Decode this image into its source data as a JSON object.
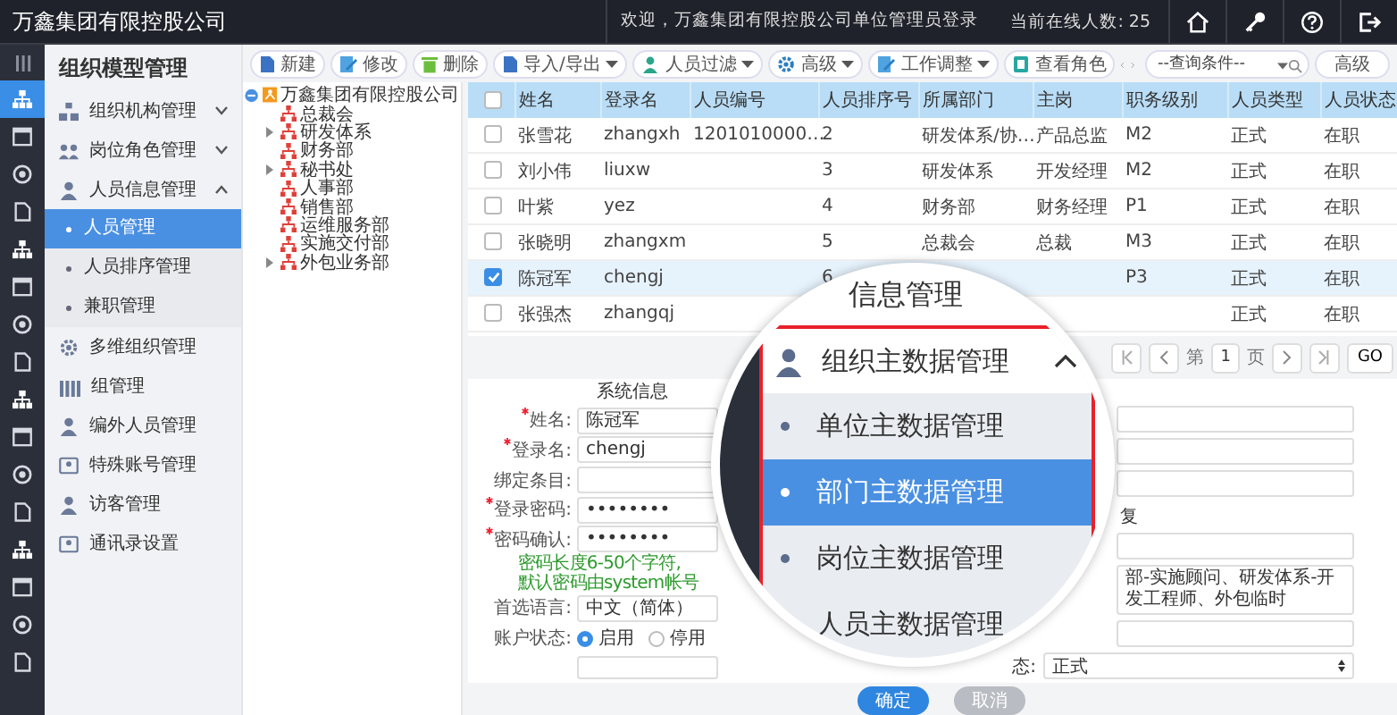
{
  "top_bar": {
    "title": "万鑫集团有限控股公司",
    "welcome": "欢迎，万鑫集团有限控股公司单位管理员登录",
    "online": "当前在线人数: 25"
  },
  "rail": [
    {
      "selected": true
    },
    {
      "selected": false
    },
    {
      "selected": false
    },
    {
      "selected": false
    },
    {
      "selected": false
    },
    {
      "selected": false
    },
    {
      "selected": false
    },
    {
      "selected": false
    },
    {
      "selected": false
    },
    {
      "selected": false
    },
    {
      "selected": false
    },
    {
      "selected": false
    },
    {
      "selected": false
    },
    {
      "selected": false
    },
    {
      "selected": false
    },
    {
      "selected": false
    }
  ],
  "sidebar": {
    "title": "组织模型管理",
    "items": [
      {
        "label": "组织机构管理",
        "expanded": false
      },
      {
        "label": "岗位角色管理",
        "expanded": false
      },
      {
        "label": "人员信息管理",
        "expanded": true,
        "children": [
          {
            "label": "人员管理",
            "selected": true
          },
          {
            "label": "人员排序管理",
            "selected": false
          },
          {
            "label": "兼职管理",
            "selected": false
          }
        ]
      },
      {
        "label": "多维组织管理"
      },
      {
        "label": "组管理"
      },
      {
        "label": "编外人员管理"
      },
      {
        "label": "特殊账号管理"
      },
      {
        "label": "访客管理"
      },
      {
        "label": "通讯录设置"
      }
    ]
  },
  "toolbar": {
    "buttons": [
      {
        "label": "新建",
        "dropdown": false
      },
      {
        "label": "修改",
        "dropdown": false
      },
      {
        "label": "删除",
        "dropdown": false
      },
      {
        "label": "导入/导出",
        "dropdown": true
      },
      {
        "label": "人员过滤",
        "dropdown": true
      },
      {
        "label": "高级",
        "dropdown": true
      },
      {
        "label": "工作调整",
        "dropdown": true
      },
      {
        "label": "查看角色",
        "dropdown": false
      }
    ],
    "search": {
      "placeholder": "--查询条件--"
    },
    "advanced": "高级"
  },
  "tree": {
    "label": "万鑫集团有限控股公司",
    "expanded": true,
    "children": [
      {
        "label": "总裁会"
      },
      {
        "label": "研发体系",
        "expanded": false
      },
      {
        "label": "财务部"
      },
      {
        "label": "秘书处",
        "expanded": false
      },
      {
        "label": "人事部"
      },
      {
        "label": "销售部"
      },
      {
        "label": "运维服务部"
      },
      {
        "label": "实施交付部"
      },
      {
        "label": "外包业务部",
        "expanded": false
      }
    ]
  },
  "table": {
    "all_selected": false,
    "columns": [
      "姓名",
      "登录名",
      "人员编号",
      "人员排序号",
      "所属部门",
      "主岗",
      "职务级别",
      "人员类型",
      "人员状态"
    ],
    "rows": [
      {
        "selected": false,
        "cells": [
          "张雪花",
          "zhangxh",
          "1201010000…",
          "2",
          "研发体系/协…",
          "产品总监",
          "M2",
          "正式",
          "在职"
        ]
      },
      {
        "selected": false,
        "cells": [
          "刘小伟",
          "liuxw",
          null,
          "3",
          "研发体系",
          "开发经理",
          "M2",
          "正式",
          "在职"
        ]
      },
      {
        "selected": false,
        "cells": [
          "叶紫",
          "yez",
          null,
          "4",
          "财务部",
          "财务经理",
          "P1",
          "正式",
          "在职"
        ]
      },
      {
        "selected": false,
        "cells": [
          "张晓明",
          "zhangxm",
          null,
          "5",
          "总裁会",
          "总裁",
          "M3",
          "正式",
          "在职"
        ]
      },
      {
        "selected": true,
        "cells": [
          "陈冠军",
          "chengj",
          null,
          "6",
          null,
          null,
          "P3",
          "正式",
          "在职"
        ]
      },
      {
        "selected": false,
        "cells": [
          "张强杰",
          "zhangqj",
          null,
          null,
          null,
          null,
          null,
          "正式",
          "在职"
        ]
      }
    ]
  },
  "pager": {
    "before": "第",
    "page": "1",
    "after": "页",
    "go": "GO"
  },
  "form": {
    "section": "系统信息",
    "left": [
      {
        "kind": "input",
        "label": "姓名:",
        "required": true,
        "value": "陈冠军"
      },
      {
        "kind": "input",
        "label": "登录名:",
        "required": true,
        "value": "chengj"
      },
      {
        "kind": "input",
        "label": "绑定条目:",
        "required": false
      },
      {
        "kind": "input",
        "label": "登录密码:",
        "required": true,
        "value": "••••••••"
      },
      {
        "kind": "input",
        "label": "密码确认:",
        "required": true,
        "value": "••••••••"
      },
      {
        "kind": "hint",
        "text": "密码长度6-50个字符,"
      },
      {
        "kind": "hint",
        "text": "默认密码由system帐号"
      },
      {
        "kind": "select",
        "label": "首选语言:",
        "required": false,
        "value": "中文（简体）"
      },
      {
        "kind": "radio",
        "label": "账户状态:",
        "required": false,
        "options": [
          {
            "label": "启用",
            "selected": true
          },
          {
            "label": "停用",
            "selected": false
          }
        ]
      },
      {
        "kind": "textarea"
      }
    ],
    "right": [
      {
        "kind": "input"
      },
      {
        "kind": "input"
      },
      {
        "kind": "input"
      },
      {
        "kind": "label",
        "text": "复"
      },
      {
        "kind": "input"
      },
      {
        "kind": "input",
        "value": "部-实施顾问、研发体系-开发工程师、外包临时"
      },
      {
        "kind": "input"
      },
      {
        "kind": "select",
        "label": "态:",
        "value": "正式"
      }
    ],
    "ok": "确定",
    "cancel": "取消"
  },
  "magnifier": {
    "partial_text": "信息管理",
    "group": {
      "label": "组织主数据管理",
      "expanded": true,
      "items": [
        {
          "label": "单位主数据管理",
          "selected": false
        },
        {
          "label": "部门主数据管理",
          "selected": true
        },
        {
          "label": "岗位主数据管理",
          "selected": false
        },
        {
          "label": "人员主数据管理",
          "selected": false
        }
      ]
    }
  }
}
